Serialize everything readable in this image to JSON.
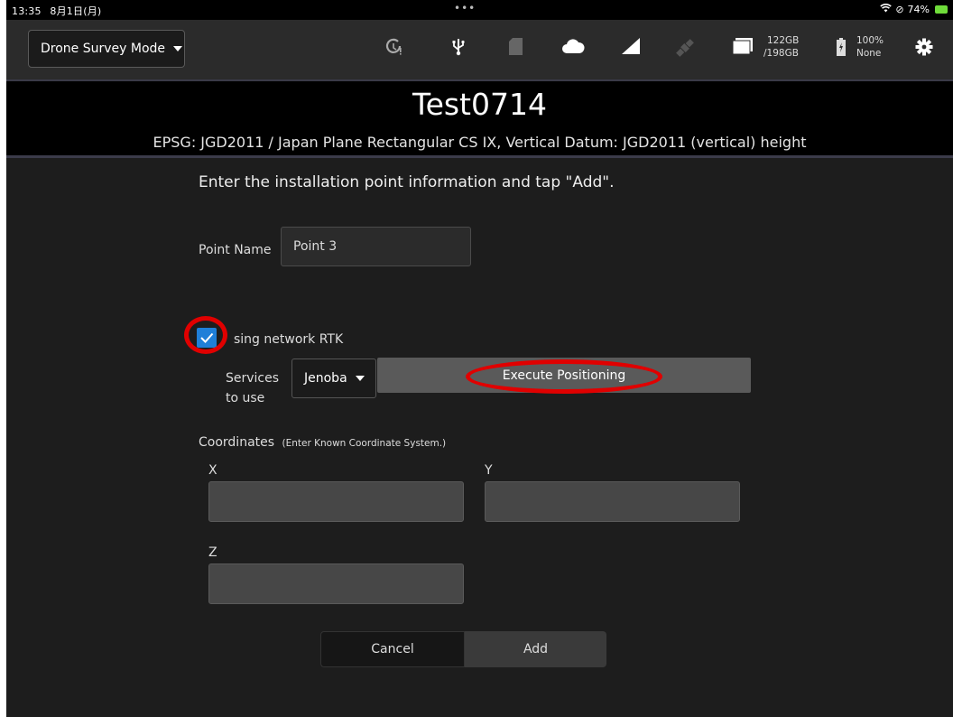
{
  "status_bar": {
    "time": "13:35",
    "date": "8月1日(月)",
    "dots": "•••",
    "battery": "74%"
  },
  "toolbar": {
    "mode_label": "Drone Survey Mode",
    "storage": {
      "line1": "122GB",
      "line2": "/198GB"
    },
    "battery": {
      "line1": "100%",
      "line2": "None"
    },
    "icons": [
      "clock-alert-icon",
      "usb-icon",
      "sd-card-icon",
      "cloud-icon",
      "signal-icon",
      "satellite-icon",
      "folder-icon",
      "battery-icon",
      "gear-icon"
    ]
  },
  "header": {
    "title": "Test0714",
    "epsg": "EPSG: JGD2011 / Japan Plane Rectangular CS IX, Vertical Datum: JGD2011 (vertical) height"
  },
  "form": {
    "instruction": "Enter the installation point information and tap \"Add\".",
    "point_name_label": "Point Name",
    "point_name_value": "Point 3",
    "rtk_label": "sing network RTK",
    "rtk_checked": true,
    "services_label_line1": "Services",
    "services_label_line2": "to use",
    "service_value": "Jenoba",
    "execute_label": "Execute Positioning",
    "coordinates_label": "Coordinates",
    "coordinates_hint": "(Enter Known Coordinate System.)",
    "x_label": "X",
    "y_label": "Y",
    "z_label": "Z",
    "x_value": "",
    "y_value": "",
    "z_value": "",
    "cancel_label": "Cancel",
    "add_label": "Add"
  },
  "colors": {
    "accent": "#1f7fd8",
    "annotation": "#e00000",
    "background": "#1d1d1d"
  }
}
